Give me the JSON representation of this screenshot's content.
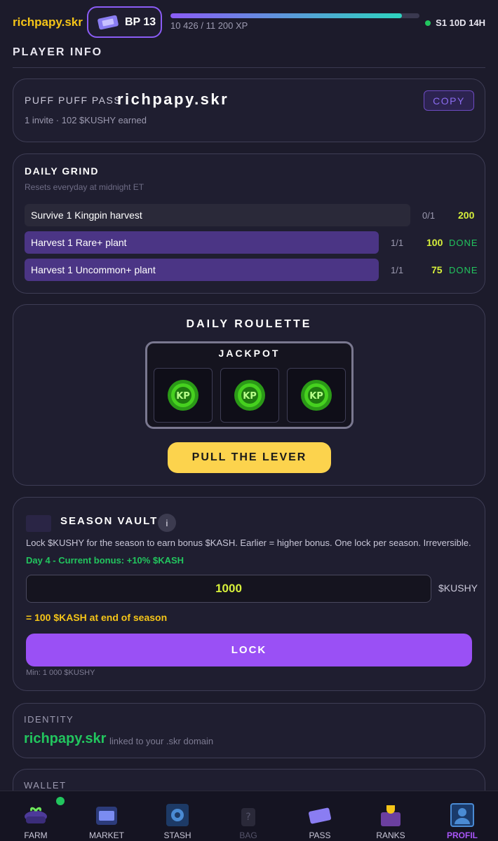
{
  "header": {
    "brand": "richpapy.skr",
    "bp_label": "BP 13",
    "xp_text": "10 426 / 11 200 XP",
    "xp_progress": 0.93,
    "season": "S1 10D 14H"
  },
  "section_title": "PLAYER INFO",
  "pass": {
    "label": "PUFF PUFF PASS",
    "name": "richpapy.skr",
    "sub": "1 invite · 102 $KUSHY earned",
    "copy_label": "COPY"
  },
  "grind": {
    "title": "DAILY GRIND",
    "subtitle": "Resets everyday at midnight ET",
    "tasks": [
      {
        "label": "Survive 1 Kingpin harvest",
        "progress": "0/1",
        "reward": "200",
        "status": ""
      },
      {
        "label": "Harvest 1 Rare+ plant",
        "progress": "1/1",
        "reward": "100",
        "status": "DONE"
      },
      {
        "label": "Harvest 1 Uncommon+ plant",
        "progress": "1/1",
        "reward": "75",
        "status": "DONE"
      }
    ]
  },
  "roulette": {
    "title": "DAILY ROULETTE",
    "jackpot": "JACKPOT",
    "lever_label": "PULL THE LEVER"
  },
  "vault": {
    "title": "SEASON VAULT",
    "info": "i",
    "description": "Lock $KUSHY for the season to earn bonus $KASH. Earlier = higher bonus. One lock per season. Irreversible.",
    "bonus": "Day 4 - Current bonus: +10% $KASH",
    "amount": "1000",
    "unit": "$KUSHY",
    "result": "= 100 $KASH at end of season",
    "lock_label": "LOCK",
    "min": "Min: 1 000 $KUSHY"
  },
  "identity": {
    "label": "IDENTITY",
    "name": "richpapy.skr",
    "sub": "linked to your .skr domain"
  },
  "wallet": {
    "label": "WALLET"
  },
  "nav": [
    {
      "label": "FARM",
      "icon": "farm-icon"
    },
    {
      "label": "MARKET",
      "icon": "market-icon"
    },
    {
      "label": "STASH",
      "icon": "stash-icon"
    },
    {
      "label": "BAG",
      "icon": "bag-icon"
    },
    {
      "label": "PASS",
      "icon": "pass-icon"
    },
    {
      "label": "RANKS",
      "icon": "ranks-icon"
    },
    {
      "label": "PROFIL",
      "icon": "profile-icon"
    }
  ],
  "colors": {
    "accent": "#9a50f5",
    "gold": "#f5c518",
    "success": "#22c55e",
    "reward": "#d7f03b"
  }
}
